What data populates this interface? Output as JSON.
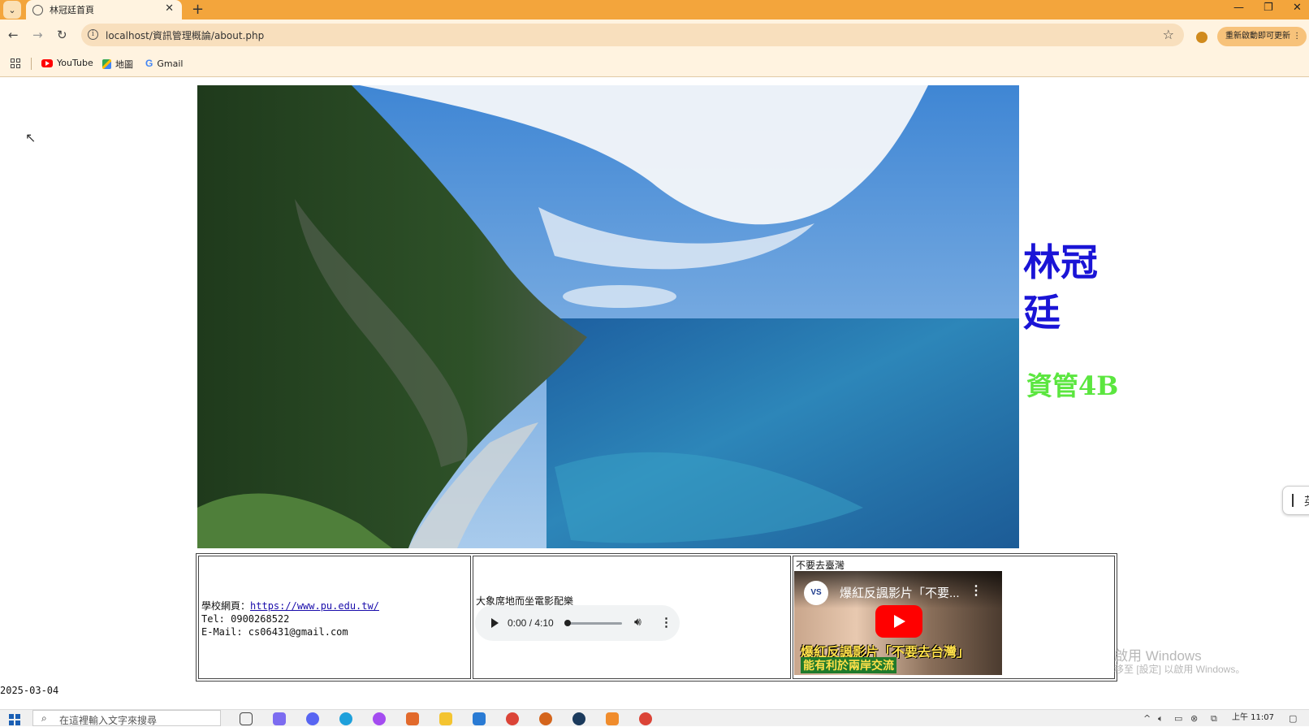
{
  "browser": {
    "tab_title": "林冠廷首頁",
    "url": "localhost/資訊管理概論/about.php",
    "update_button": "重新啟動即可更新",
    "bookmarks": [
      "YouTube",
      "地圖",
      "Gmail"
    ]
  },
  "page": {
    "name": "林冠廷",
    "class_name": "資管4B",
    "contact": {
      "website_label": "學校網頁：",
      "website_url": "https://www.pu.edu.tw/",
      "tel": "Tel: 0900268522",
      "email": "E-Mail: cs06431@gmail.com"
    },
    "audio": {
      "label": "大象席地而坐電影配樂",
      "time": "0:00 / 4:10"
    },
    "video": {
      "label": "不要去臺灣",
      "title": "爆紅反諷影片「不要...",
      "channel_logo": "VS",
      "caption1": "爆紅反諷影片「不要去台灣」",
      "caption2": "能有利於兩岸交流"
    },
    "date": "2025-03-04"
  },
  "os": {
    "watermark_title": "啟用 Windows",
    "watermark_sub": "移至 [設定] 以啟用 Windows。",
    "search_placeholder": "在這裡輸入文字來搜尋",
    "clock": "上午 11:07"
  },
  "colors": {
    "tabbar": "#f3a53c",
    "name": "#1a14d6",
    "class_name": "#5be63f"
  }
}
